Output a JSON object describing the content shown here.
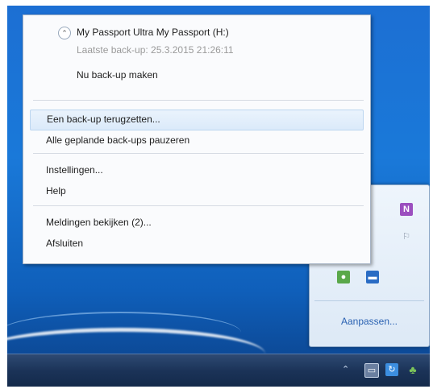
{
  "device": {
    "name": "My Passport Ultra  My Passport (H:)",
    "last_backup": "Laatste back-up: 25.3.2015 21:26:11",
    "backup_now": "Nu back-up maken"
  },
  "menu": {
    "restore": "Een back-up terugzetten...",
    "pause": "Alle geplande back-ups pauzeren",
    "settings": "Instellingen...",
    "help": "Help",
    "notifications": "Meldingen bekijken (2)...",
    "exit": "Afsluiten"
  },
  "overflow": {
    "customize": "Aanpassen..."
  },
  "tray": {
    "arrow": "⌃"
  },
  "colors": {
    "desktop": "#1a79d9",
    "highlight": "#dbeafa",
    "link": "#2b62b2"
  }
}
